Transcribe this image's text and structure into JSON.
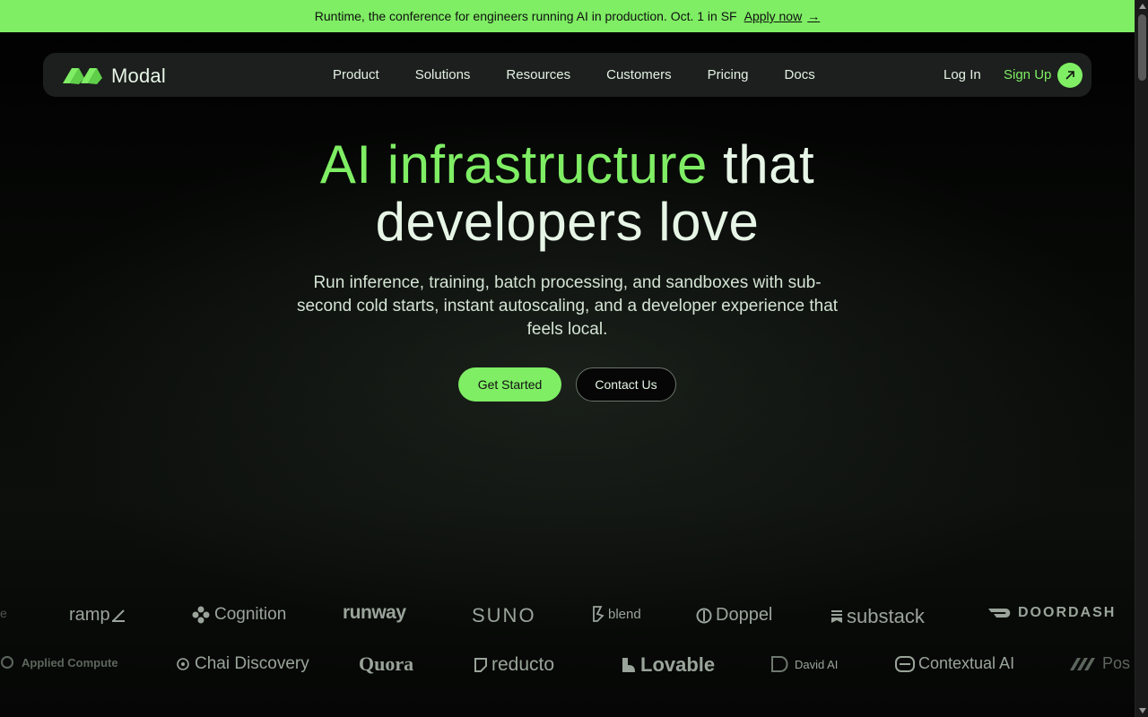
{
  "banner": {
    "text": "Runtime, the conference for engineers running AI in production. Oct. 1 in SF",
    "link": "Apply now",
    "arrow_icon": "arrow-right-icon"
  },
  "nav": {
    "brand": "Modal",
    "items": [
      {
        "label": "Product"
      },
      {
        "label": "Solutions"
      },
      {
        "label": "Resources"
      },
      {
        "label": "Customers"
      },
      {
        "label": "Pricing"
      },
      {
        "label": "Docs"
      }
    ],
    "login": "Log In",
    "signup": "Sign Up"
  },
  "hero": {
    "title_accent": "AI infrastructure",
    "title_rest_1": "that",
    "title_rest_2": "developers love",
    "subtitle": "Run inference, training, batch processing, and sandboxes with sub-second cold starts, instant autoscaling, and a developer experience that feels local.",
    "primary_cta": "Get Started",
    "secondary_cta": "Contact Us"
  },
  "customers": {
    "row1": [
      {
        "name": "ramp"
      },
      {
        "name": "Cognition"
      },
      {
        "name": "runway"
      },
      {
        "name": "SUNO"
      },
      {
        "name": "blend"
      },
      {
        "name": "Doppel"
      },
      {
        "name": "substack"
      },
      {
        "name": "DOORDASH"
      }
    ],
    "row2": [
      {
        "name": "Applied Compute"
      },
      {
        "name": "Chai Discovery"
      },
      {
        "name": "Quora"
      },
      {
        "name": "reducto"
      },
      {
        "name": "Lovable"
      },
      {
        "name": "David AI"
      },
      {
        "name": "Contextual AI"
      },
      {
        "name": "Pos"
      }
    ]
  },
  "colors": {
    "accent": "#7fee64",
    "background": "#000000",
    "nav_bg": "#1c1f1d"
  }
}
